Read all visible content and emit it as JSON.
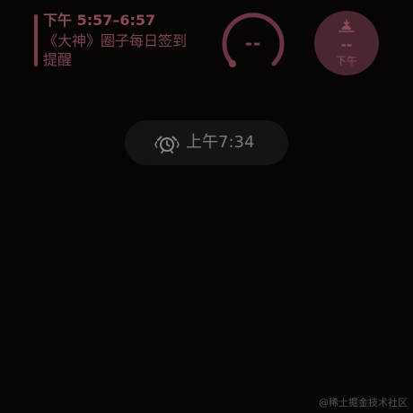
{
  "reminder": {
    "time_range": "下午 5:57–6:57",
    "title": "《大神》圈子每日签到提醒"
  },
  "ring_widget": {
    "value": "--"
  },
  "sunset_widget": {
    "value": "--",
    "label": "下午",
    "icon": "sunset-icon"
  },
  "alarm": {
    "time": "上午7:34",
    "icon": "alarm-clock-icon"
  },
  "watermark": "@稀土掘金技术社区",
  "colors": {
    "background": "#060504",
    "accent": "#7a3e4b",
    "accent_dark": "#4a2730",
    "pill": "#151413",
    "muted_text": "#7c7b79"
  }
}
